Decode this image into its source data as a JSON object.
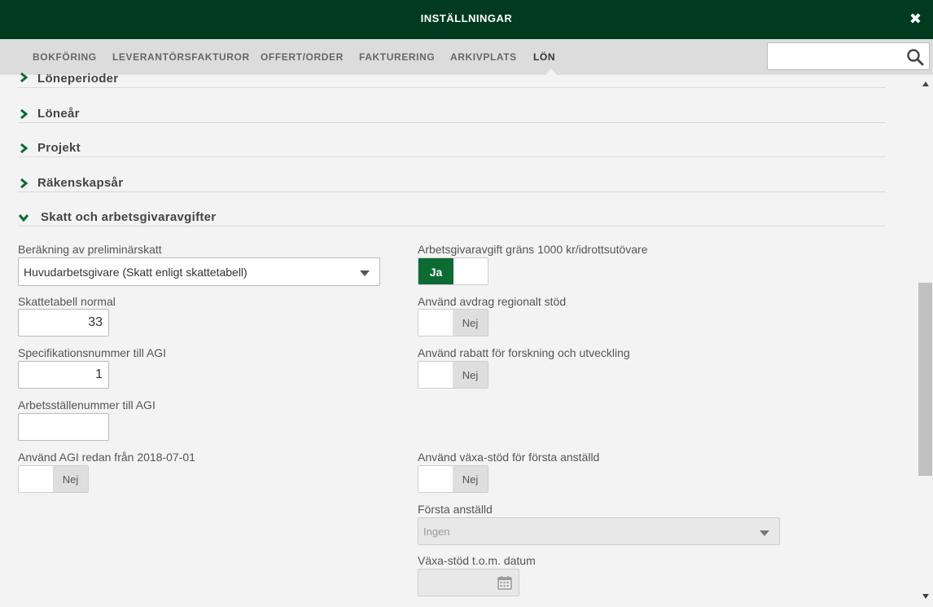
{
  "header": {
    "title": "INSTÄLLNINGAR",
    "close_icon": "close-icon"
  },
  "tabs": [
    {
      "label": "BOKFÖRING"
    },
    {
      "label": "LEVERANTÖRSFAKTUROR"
    },
    {
      "label": "OFFERT/ORDER"
    },
    {
      "label": "FAKTURERING"
    },
    {
      "label": "ARKIVPLATS"
    },
    {
      "label": "LÖN",
      "active": true
    }
  ],
  "search": {
    "placeholder": "",
    "icon": "search-icon"
  },
  "sections": [
    {
      "label": "Löneperioder",
      "expanded": false
    },
    {
      "label": "Löneår",
      "expanded": false
    },
    {
      "label": "Projekt",
      "expanded": false
    },
    {
      "label": "Räkenskapsår",
      "expanded": false
    },
    {
      "label": "Skatt och arbetsgivaravgifter",
      "expanded": true
    }
  ],
  "form": {
    "prelim_tax": {
      "label": "Beräkning av preliminärskatt",
      "value": "Huvudarbetsgivare (Skatt enligt skattetabell)"
    },
    "tax_table": {
      "label": "Skattetabell normal",
      "value": "33"
    },
    "spec_number": {
      "label": "Specifikationsnummer till AGI",
      "value": "1"
    },
    "workplace_number": {
      "label": "Arbetsställenummer till AGI",
      "value": ""
    },
    "agi_from": {
      "label": "Använd AGI redan från 2018-07-01",
      "state": "Nej"
    },
    "employer_fee_limit": {
      "label": "Arbetsgivaravgift gräns 1000 kr/idrottsutövare",
      "state": "Ja"
    },
    "regional_support": {
      "label": "Använd avdrag regionalt stöd",
      "state": "Nej"
    },
    "research_discount": {
      "label": "Använd rabatt för forskning och utveckling",
      "state": "Nej"
    },
    "vaxa_support": {
      "label": "Använd växa-stöd för första anställd",
      "state": "Nej"
    },
    "first_employee": {
      "label": "Första anställd",
      "value": "Ingen"
    },
    "vaxa_until": {
      "label": "Växa-stöd t.o.m. datum",
      "value": ""
    }
  },
  "colors": {
    "header_bg": "#003a1f",
    "toggle_on": "#0b6b33",
    "tab_bar": "#dcdcdc",
    "background": "#f3f3f3"
  }
}
